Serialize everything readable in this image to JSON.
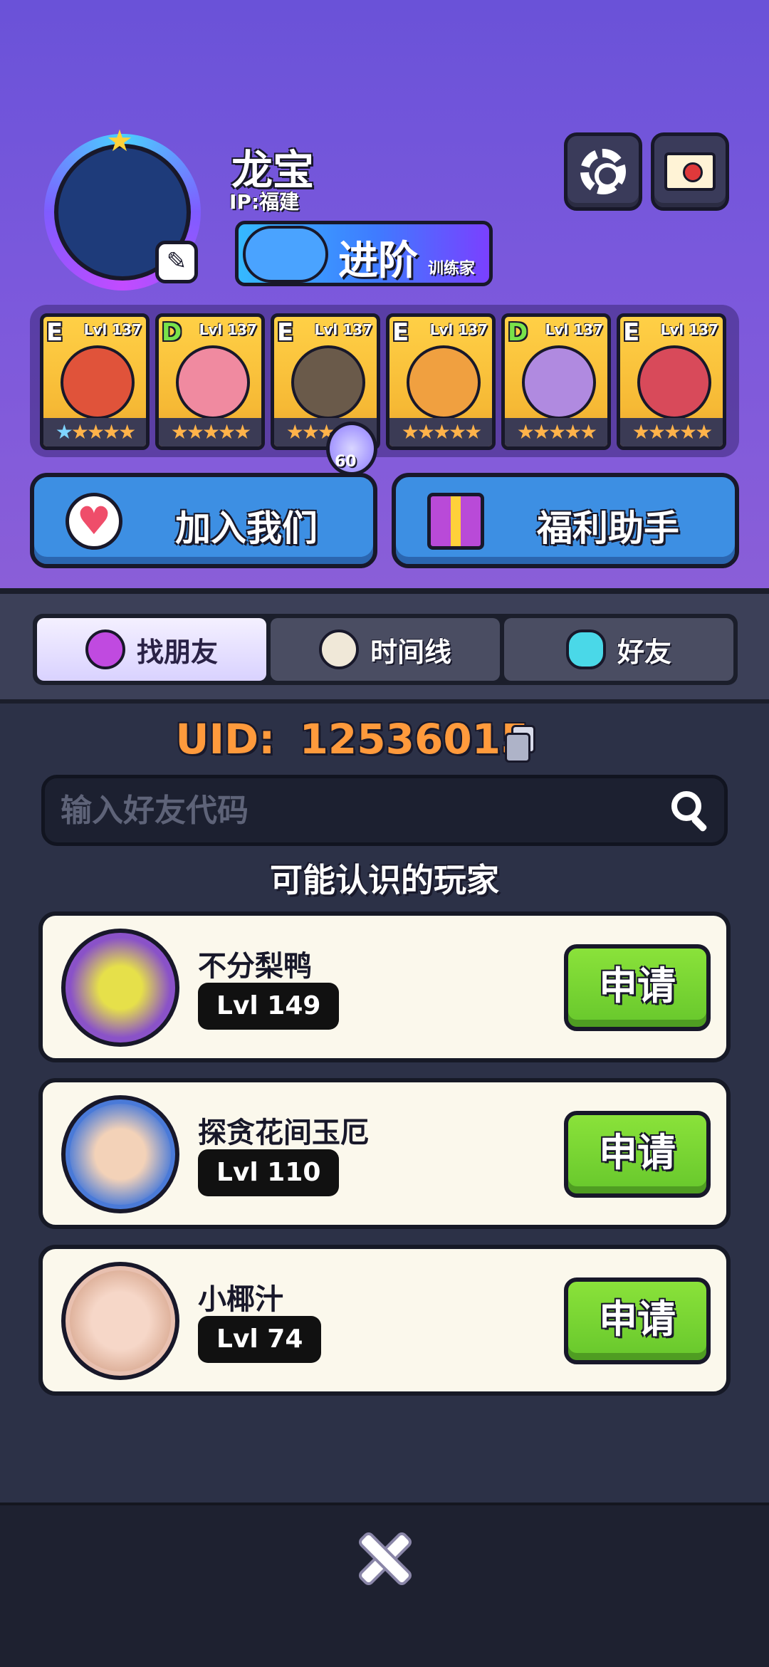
{
  "profile": {
    "name": "龙宝",
    "ip": "IP:福建",
    "rank_main": "进阶",
    "rank_sub": "训练家"
  },
  "monsters": [
    {
      "grade": "E",
      "level": "Lvl 137",
      "stars": "★★★★★",
      "color": "#e0533a"
    },
    {
      "grade": "D",
      "level": "Lvl 137",
      "stars": "★★★★★",
      "color": "#f08aa0"
    },
    {
      "grade": "E",
      "level": "Lvl 137",
      "stars": "★★★★★",
      "color": "#6a5a4a"
    },
    {
      "grade": "E",
      "level": "Lvl 137",
      "stars": "★★★★★",
      "color": "#f0a040"
    },
    {
      "grade": "D",
      "level": "Lvl 137",
      "stars": "★★★★★",
      "color": "#b08ae0"
    },
    {
      "grade": "E",
      "level": "Lvl 137",
      "stars": "★★★★★",
      "color": "#d84a5a"
    }
  ],
  "gem_count": "60",
  "actions": {
    "join_label": "加入我们",
    "welfare_label": "福利助手"
  },
  "tabs": [
    {
      "label": "找朋友",
      "icon": "magnifier-icon",
      "active": true
    },
    {
      "label": "时间线",
      "icon": "clock-icon",
      "active": false
    },
    {
      "label": "好友",
      "icon": "chat-icon",
      "active": false
    }
  ],
  "uid": {
    "prefix": "UID:",
    "value": "12536015"
  },
  "search": {
    "placeholder": "输入好友代码"
  },
  "suggested_title": "可能认识的玩家",
  "players": [
    {
      "name": "不分梨鸭",
      "level": "Lvl 149",
      "apply": "申请",
      "avatar_color": "#8a52c8"
    },
    {
      "name": "探贪花间玉厄",
      "level": "Lvl 110",
      "apply": "申请",
      "avatar_color": "#4a7ad8"
    },
    {
      "name": "小椰汁",
      "level": "Lvl 74",
      "apply": "申请",
      "avatar_color": "#e8c0b0"
    }
  ],
  "colors": {
    "uid": "#ff9a3c",
    "apply_button": "#7ad432",
    "action_button": "#3d8fe3"
  }
}
